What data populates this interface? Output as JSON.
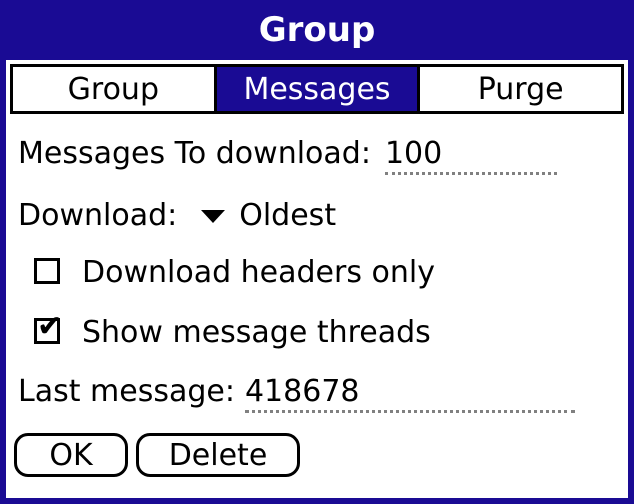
{
  "window": {
    "title": "Group"
  },
  "tabs": [
    {
      "label": "Group",
      "active": false
    },
    {
      "label": "Messages",
      "active": true
    },
    {
      "label": "Purge",
      "active": false
    }
  ],
  "fields": {
    "messages_to_download": {
      "label": "Messages To download:",
      "value": "100"
    },
    "download": {
      "label": "Download:",
      "selected": "Oldest"
    },
    "download_headers_only": {
      "label": "Download headers only",
      "checked": false
    },
    "show_message_threads": {
      "label": "Show message threads",
      "checked": true
    },
    "last_message": {
      "label": "Last message:",
      "value": "418678"
    }
  },
  "buttons": {
    "ok": "OK",
    "delete": "Delete"
  },
  "colors": {
    "accent": "#1a0b94",
    "background": "#ffffff",
    "text": "#000000"
  }
}
